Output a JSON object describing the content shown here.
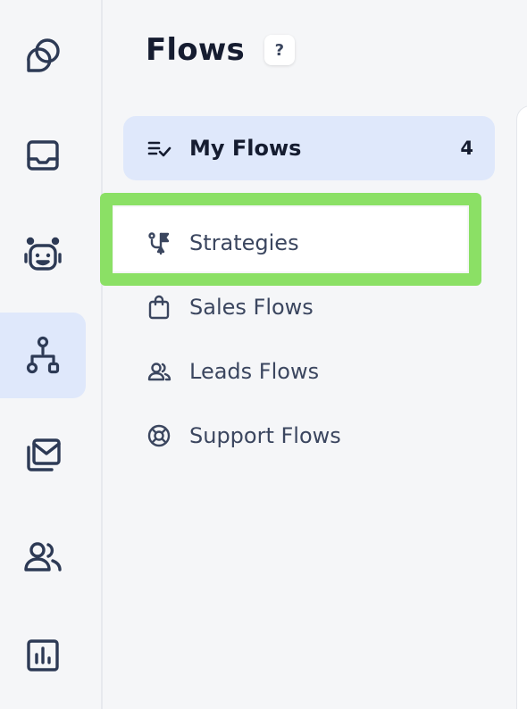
{
  "panel": {
    "title": "Flows",
    "help_label": "?"
  },
  "rail": {
    "items": [
      {
        "icon": "chat-bubbles-icon",
        "active": false
      },
      {
        "icon": "inbox-icon",
        "active": false
      },
      {
        "icon": "bot-icon",
        "active": false
      },
      {
        "icon": "flow-hierarchy-icon",
        "active": true
      },
      {
        "icon": "campaign-mail-icon",
        "active": false
      },
      {
        "icon": "contacts-icon",
        "active": false
      },
      {
        "icon": "reports-icon",
        "active": false
      }
    ]
  },
  "nav": {
    "my_flows": {
      "label": "My Flows",
      "count": "4",
      "icon": "checklist-icon"
    },
    "strategies": {
      "label": "Strategies",
      "icon": "strategy-flag-icon"
    },
    "sales_flows": {
      "label": "Sales Flows",
      "icon": "shopping-bag-icon"
    },
    "leads_flows": {
      "label": "Leads Flows",
      "icon": "people-icon"
    },
    "support_flows": {
      "label": "Support Flows",
      "icon": "lifebuoy-icon"
    }
  },
  "colors": {
    "accent_bg": "#dfe8fb",
    "highlight": "#8be065",
    "text_dark": "#151c30",
    "text": "#3b465f"
  }
}
